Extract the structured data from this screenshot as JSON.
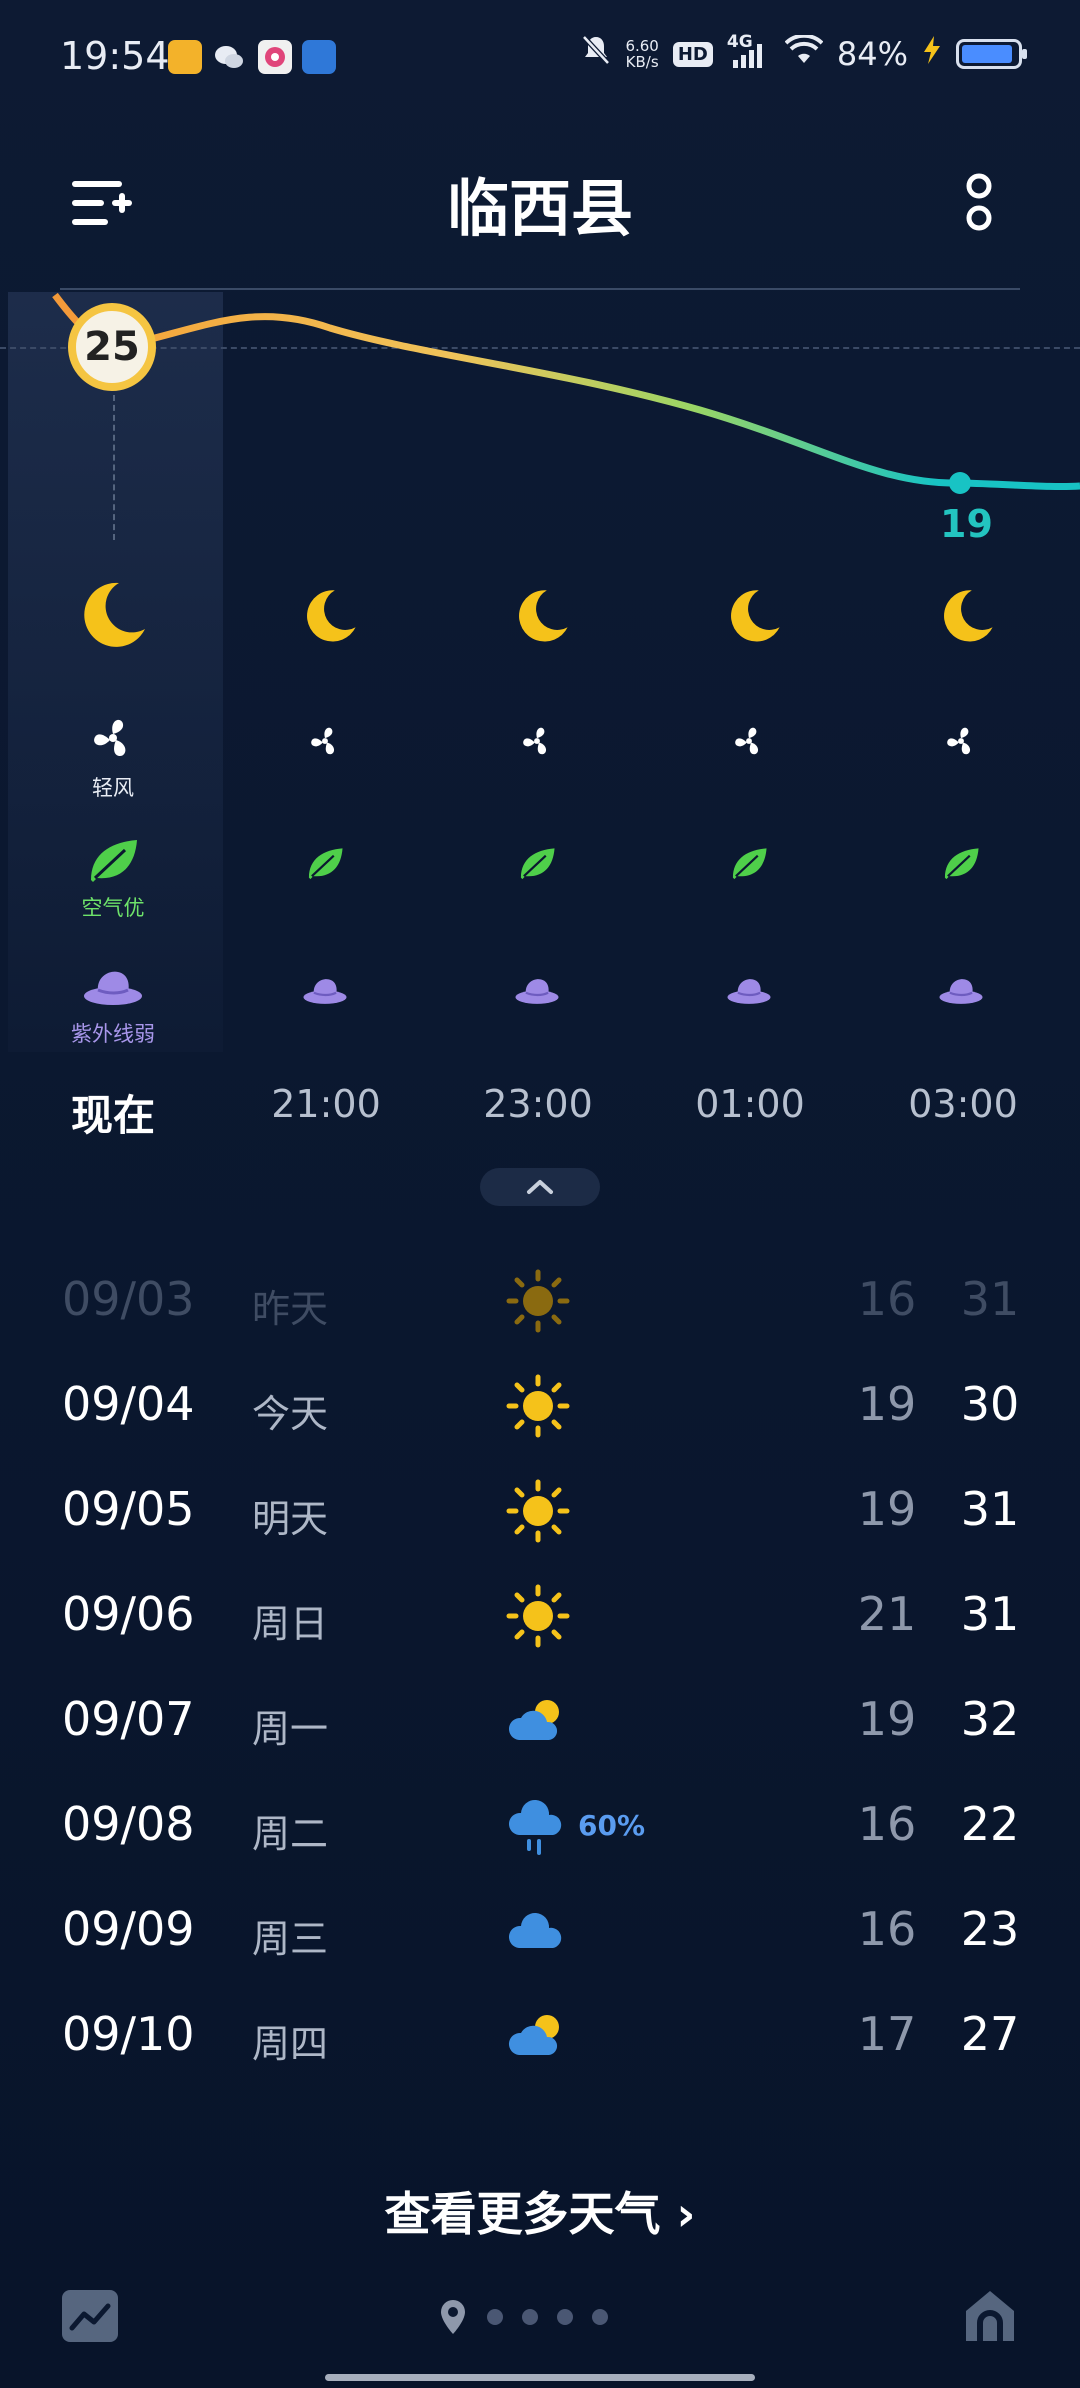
{
  "status_bar": {
    "time": "19:54",
    "net_speed_value": "6.60",
    "net_speed_unit": "KB/s",
    "hd": "HD",
    "network": "4G",
    "battery": "84%",
    "battery_level": 0.84
  },
  "header": {
    "title": "临西县"
  },
  "hourly": {
    "current_temp": "25",
    "low_temp": "19",
    "labels": [
      "现在",
      "21:00",
      "23:00",
      "01:00",
      "03:00"
    ],
    "now_wind_label": "轻风",
    "now_air_label": "空气优",
    "now_uv_label": "紫外线弱"
  },
  "daily": [
    {
      "date": "09/03",
      "day": "昨天",
      "icon": "sun-icon",
      "pop": "",
      "low": "16",
      "high": "31"
    },
    {
      "date": "09/04",
      "day": "今天",
      "icon": "sun-icon",
      "pop": "",
      "low": "19",
      "high": "30"
    },
    {
      "date": "09/05",
      "day": "明天",
      "icon": "sun-icon",
      "pop": "",
      "low": "19",
      "high": "31"
    },
    {
      "date": "09/06",
      "day": "周日",
      "icon": "sun-icon",
      "pop": "",
      "low": "21",
      "high": "31"
    },
    {
      "date": "09/07",
      "day": "周一",
      "icon": "partly-cloudy-icon",
      "pop": "",
      "low": "19",
      "high": "32"
    },
    {
      "date": "09/08",
      "day": "周二",
      "icon": "rain-cloud-icon",
      "pop": "60%",
      "low": "16",
      "high": "22"
    },
    {
      "date": "09/09",
      "day": "周三",
      "icon": "cloud-icon",
      "pop": "",
      "low": "16",
      "high": "23"
    },
    {
      "date": "09/10",
      "day": "周四",
      "icon": "partly-cloudy-icon",
      "pop": "",
      "low": "17",
      "high": "27"
    }
  ],
  "footer": {
    "more_link": "查看更多天气 ›"
  },
  "colors": {
    "accent_sun": "#f5c21a",
    "curve_start": "#f5a53a",
    "curve_end": "#18c3c4",
    "rain_blue": "#5a9cf0",
    "leaf_green": "#4fcf4a",
    "uv_purple": "#9e8ae6"
  }
}
